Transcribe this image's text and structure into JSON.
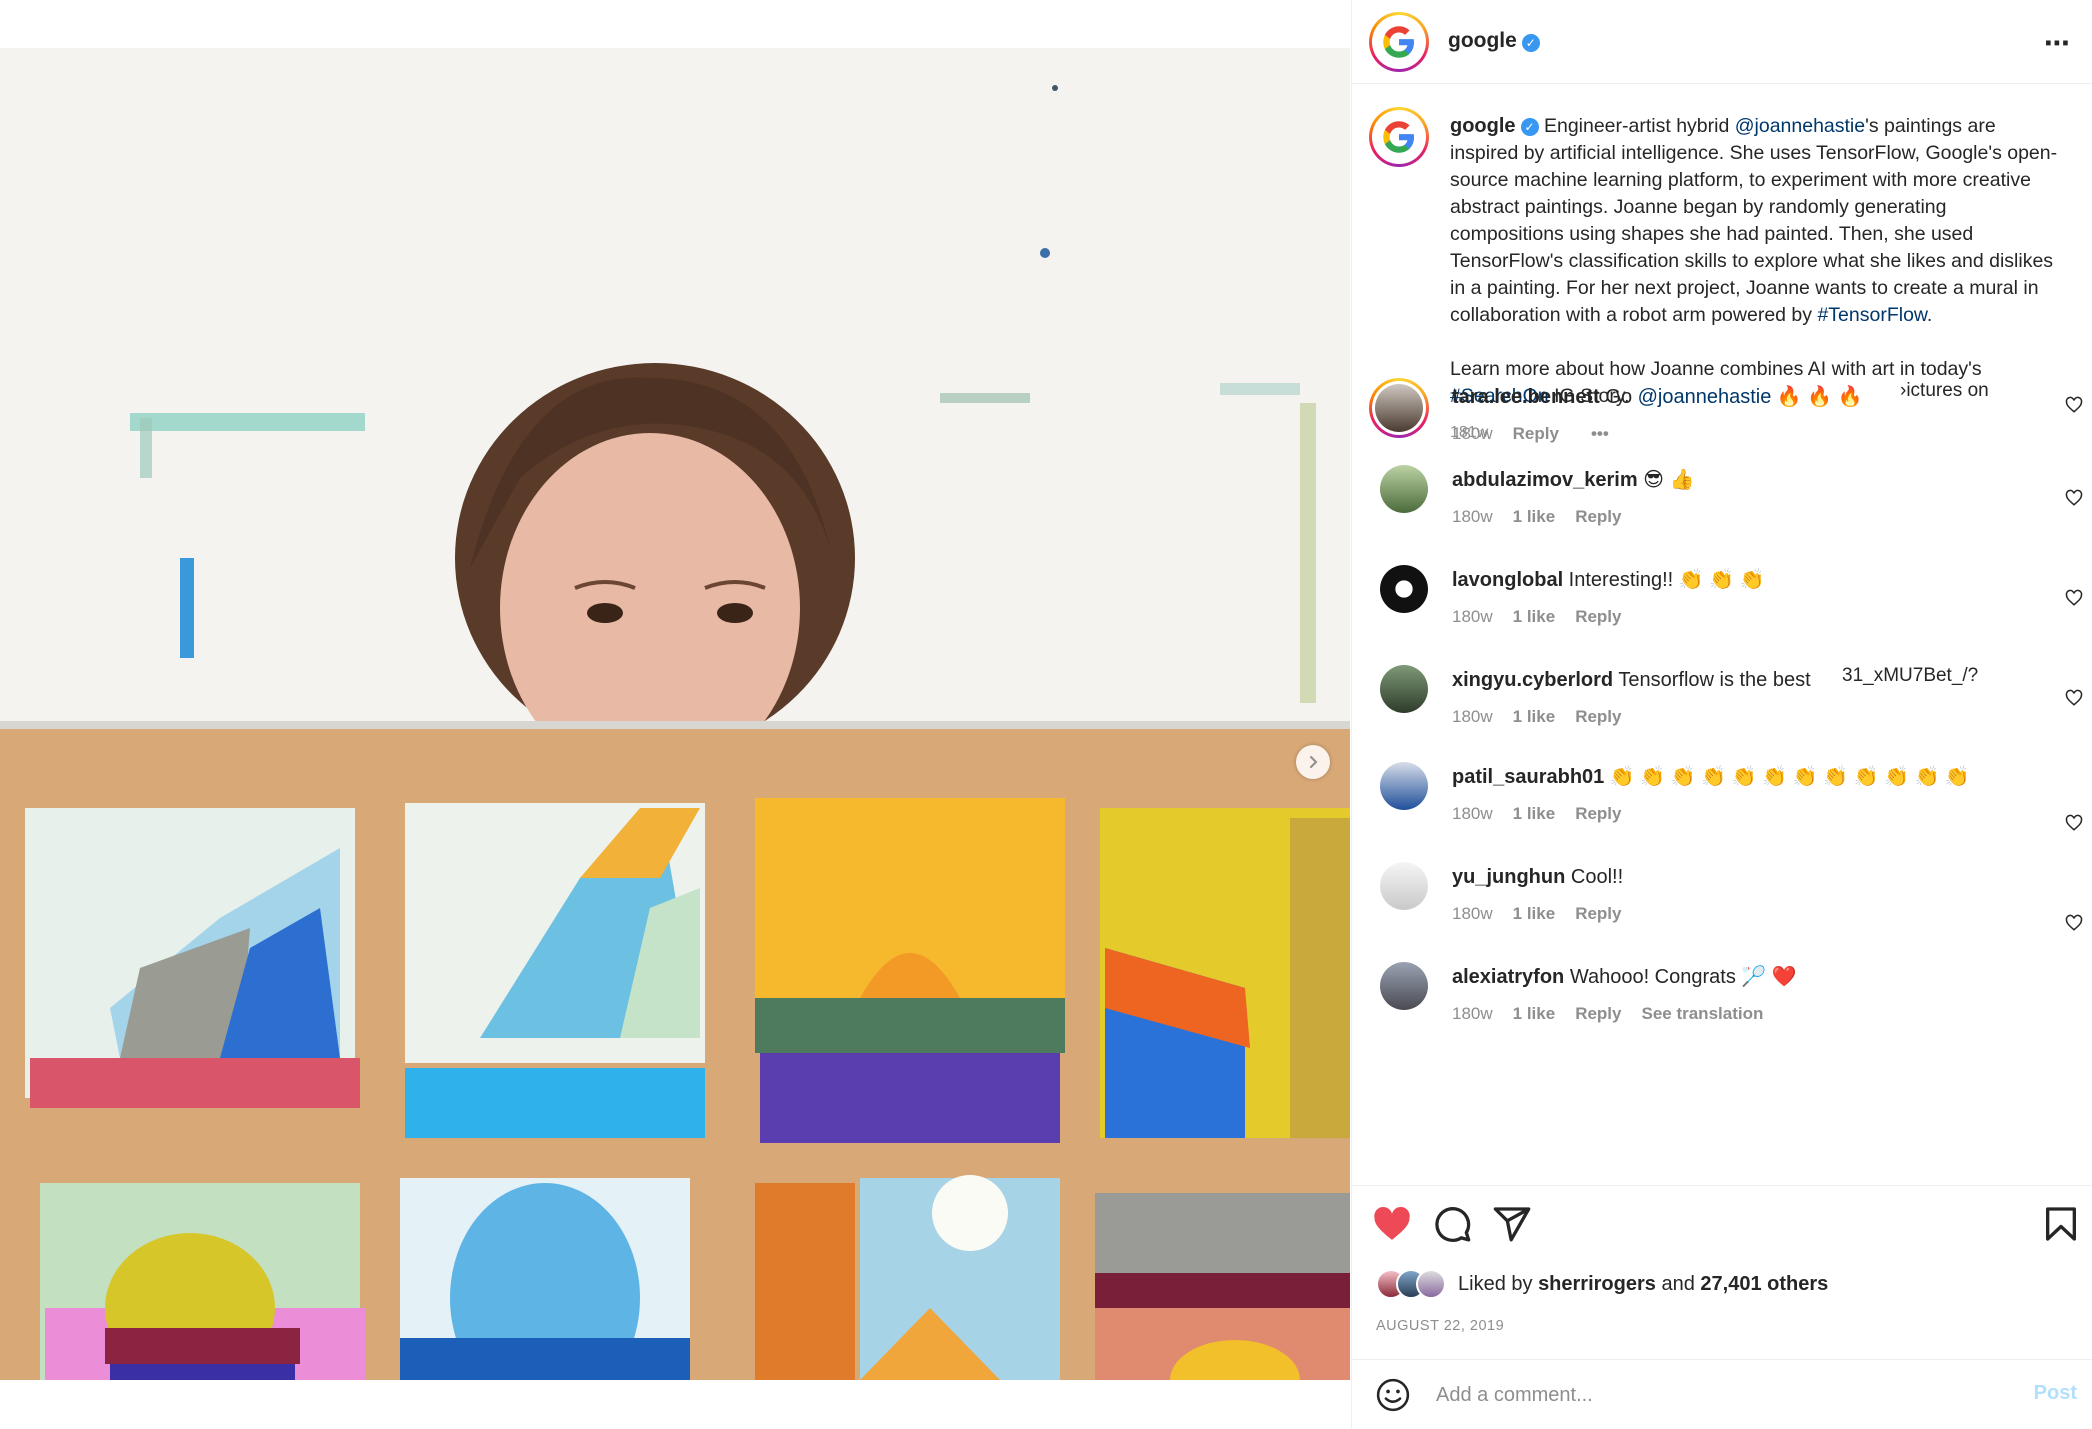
{
  "post": {
    "account": "google",
    "verified_mark": "✓",
    "caption": {
      "username": "google",
      "text_1": " Engineer-artist hybrid ",
      "mention": "@joannehastie",
      "text_2": "'s paintings are inspired by artificial intelligence. She uses TensorFlow, Google's open-source machine learning platform, to experiment with more creative abstract paintings. Joanne began by randomly generating compositions using shapes she had painted. Then, she used TensorFlow's classification skills to explore what she likes and dislikes in a painting. For her next project, Joanne wants to create a mural in collaboration with a robot arm powered by ",
      "hashtag_1": "#TensorFlow",
      "text_3": ".",
      "text_4": "Learn more about how Joanne combines AI with art in today's ",
      "hashtag_2": "#SearchOn",
      "text_5": " IG Story.",
      "time": "181w"
    },
    "comments": [
      {
        "user": "tara.lee.bennett",
        "text_pre": " Go ",
        "mention": "@joannehastie",
        "text_post": " 🔥 🔥 🔥",
        "time": "180w",
        "likes": "",
        "reply": "Reply",
        "more": "•••",
        "extra": ""
      },
      {
        "user": "abdulazimov_kerim",
        "text_pre": " 😎 👍",
        "mention": "",
        "text_post": "",
        "time": "180w",
        "likes": "1 like",
        "reply": "Reply",
        "extra": ""
      },
      {
        "user": "lavonglobal",
        "text_pre": " Interesting!! 👏 👏 👏",
        "mention": "",
        "text_post": "",
        "time": "180w",
        "likes": "1 like",
        "reply": "Reply",
        "extra": ""
      },
      {
        "user": "xingyu.cyberlord",
        "text_pre": " Tensorflow is the best",
        "mention": "",
        "text_post": "",
        "time": "180w",
        "likes": "1 like",
        "reply": "Reply",
        "extra": ""
      },
      {
        "user": "patil_saurabh01",
        "text_pre": " 👏 👏 👏 👏 👏 👏 👏 👏 👏 👏 👏 👏",
        "mention": "",
        "text_post": "",
        "time": "180w",
        "likes": "1 like",
        "reply": "Reply",
        "extra": ""
      },
      {
        "user": "yu_junghun",
        "text_pre": " Cool!!",
        "mention": "",
        "text_post": "",
        "time": "180w",
        "likes": "1 like",
        "reply": "Reply",
        "extra": ""
      },
      {
        "user": "alexiatryfon",
        "text_pre": " Wahooo! Congrats 🏸 ❤️",
        "mention": "",
        "text_post": "",
        "time": "180w",
        "likes": "1 like",
        "reply": "Reply",
        "extra": "See translation"
      }
    ],
    "stray_text": {
      "pictures": "›ictures on",
      "url_fragment": "31_xMU7Bet_/?"
    },
    "likes": {
      "prefix": "Liked by ",
      "user": "sherrirogers",
      "middle": " and ",
      "count": "27,401 others"
    },
    "date": "AUGUST 22, 2019",
    "add_comment": {
      "placeholder": "Add a comment...",
      "post_label": "Post"
    }
  },
  "carousel": {
    "current": 1,
    "total": 2
  },
  "colors": {
    "like_red": "#ed4956",
    "link": "#00376b",
    "verified": "#3897f0",
    "muted": "#8e8e8e",
    "post_disabled": "#b2dffc"
  },
  "icons": [
    "more-icon",
    "heart-icon",
    "comment-icon",
    "share-icon",
    "bookmark-icon",
    "emoji-icon",
    "chevron-right-icon"
  ]
}
